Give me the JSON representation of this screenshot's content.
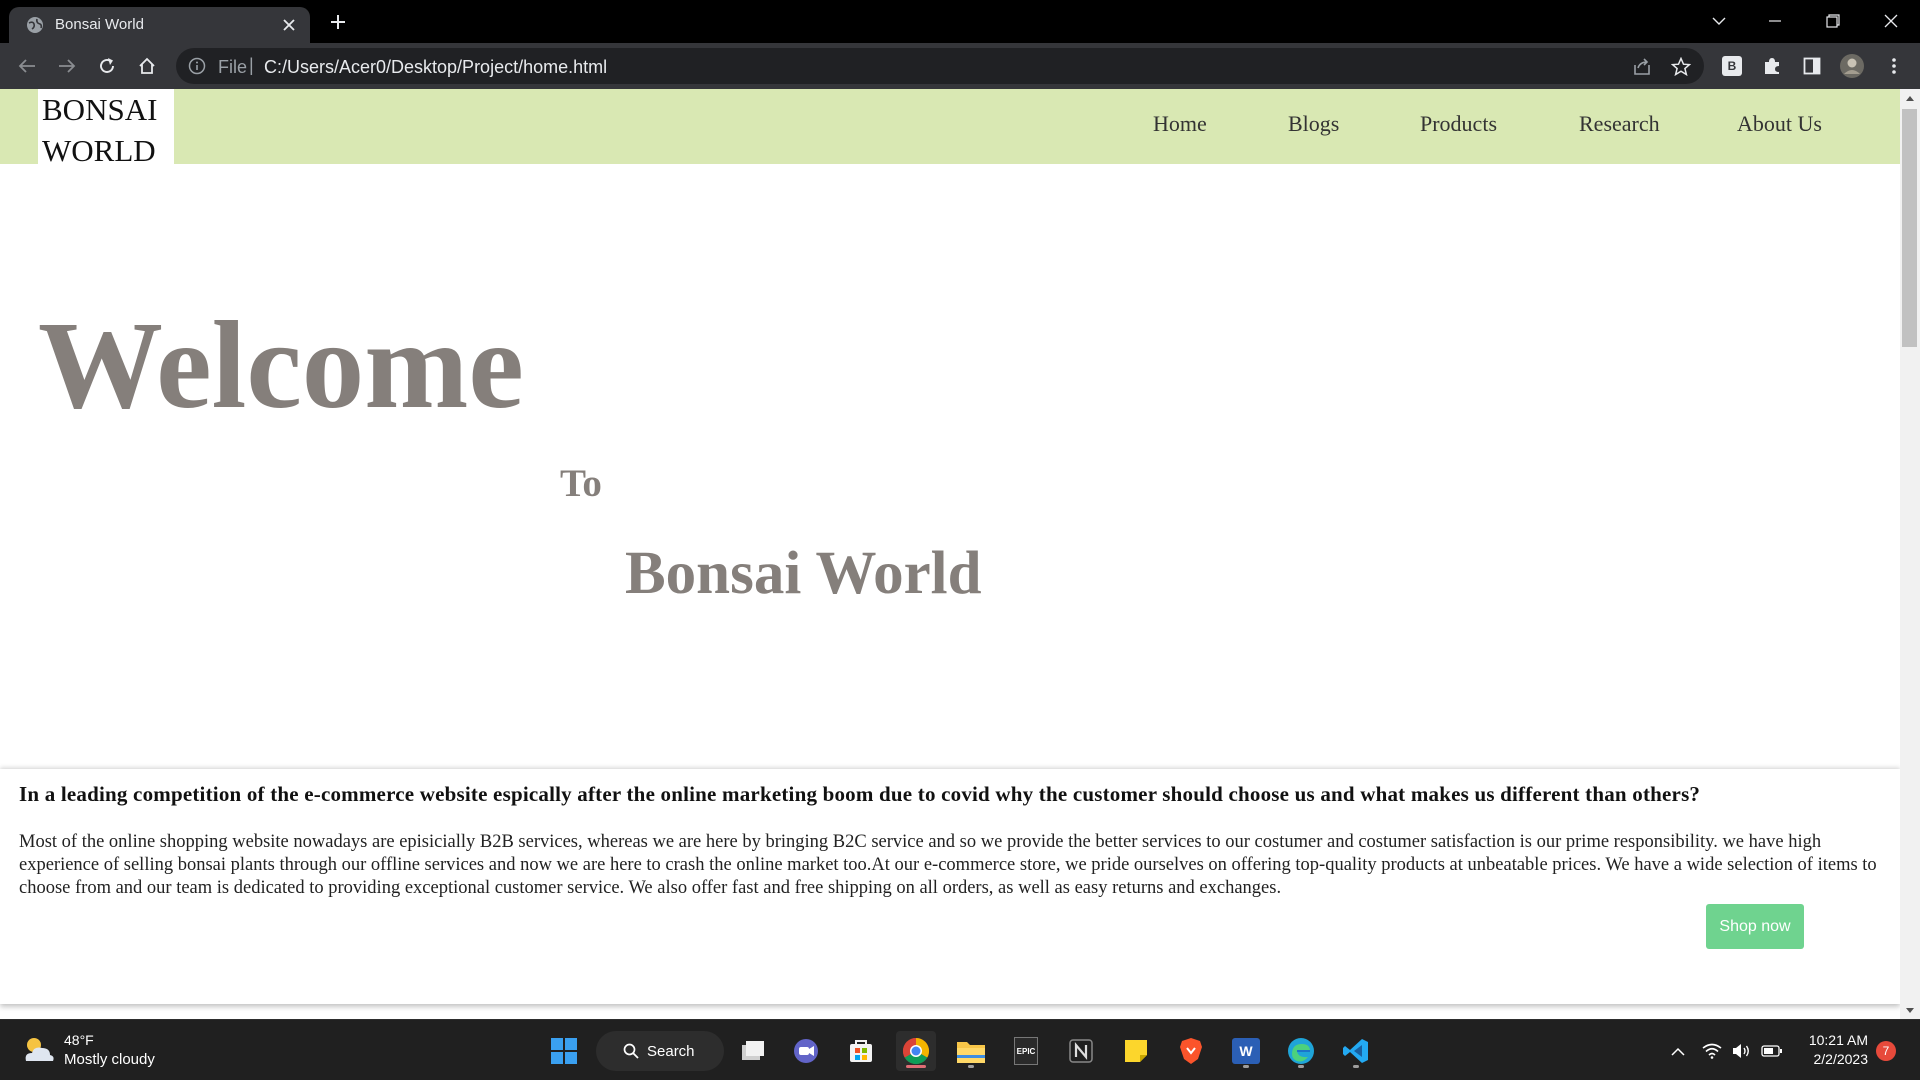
{
  "browser": {
    "tab_title": "Bonsai World",
    "url_scheme": "File",
    "url_separator": "|",
    "url": "C:/Users/Acer0/Desktop/Project/home.html",
    "profile_badge": "B"
  },
  "site": {
    "logo_line1": "BONSAI",
    "logo_line2": "WORLD",
    "nav": [
      "Home",
      "Blogs",
      "Products",
      "Research",
      "About Us"
    ],
    "hero": {
      "welcome": "Welcome",
      "to": "To",
      "name": "Bonsai World"
    },
    "info": {
      "title": "In a leading competition of the e-commerce website espically after the online marketing boom due to covid why the customer should choose us and what makes us different than others?",
      "body": "Most of the online shopping website nowadays are episicially B2B services, whereas we are here by bringing B2C service and so we provide the better services to our costumer and costumer satisfaction is our prime responsibility. we have high experience of selling bonsai plants through our offline services and now we are here to crash the online market too.At our e-commerce store, we pride ourselves on offering top-quality products at unbeatable prices. We have a wide selection of items to choose from and our team is dedicated to providing exceptional customer service. We also offer fast and free shipping on all orders, as well as easy returns and exchanges.",
      "button": "Shop now"
    },
    "colors": {
      "header_bg": "#d9e8b3",
      "hero_text": "#857f7b",
      "button_bg": "#6fd38f"
    }
  },
  "taskbar": {
    "weather_temp": "48°F",
    "weather_desc": "Mostly cloudy",
    "search_label": "Search",
    "epic_label": "EPIC",
    "word_label": "W",
    "time": "10:21 AM",
    "date": "2/2/2023",
    "notifications": "7"
  }
}
